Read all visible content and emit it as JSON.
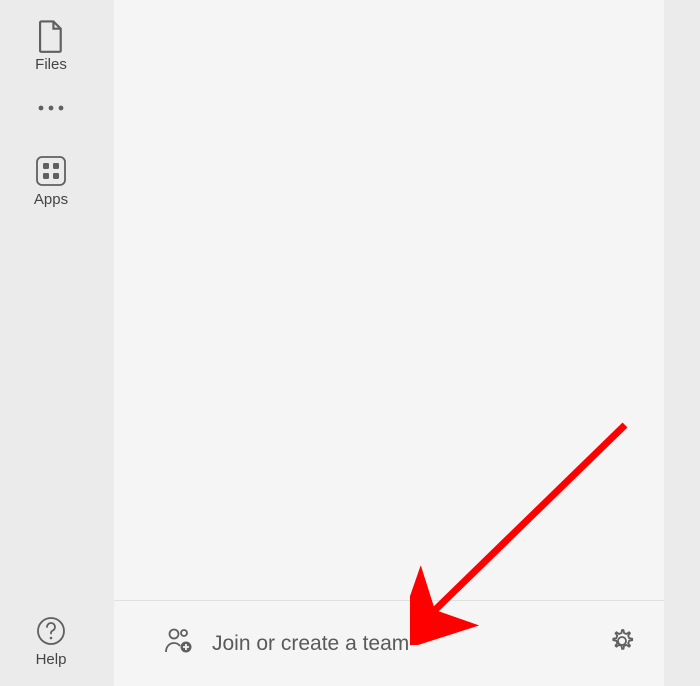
{
  "sidebar": {
    "files_label": "Files",
    "apps_label": "Apps",
    "help_label": "Help"
  },
  "bottom_bar": {
    "join_team_label": "Join or create a team"
  },
  "colors": {
    "arrow": "#ff0000",
    "icon_stroke": "#606060"
  }
}
